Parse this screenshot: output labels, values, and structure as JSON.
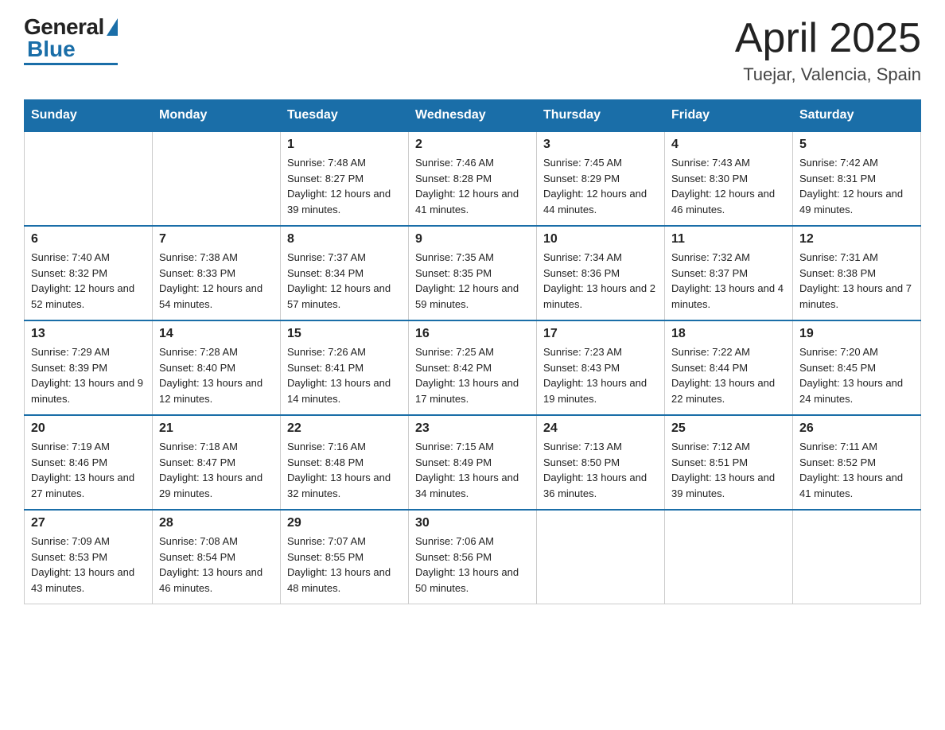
{
  "logo": {
    "general": "General",
    "blue": "Blue",
    "underline": "Blue"
  },
  "header": {
    "title": "April 2025",
    "subtitle": "Tuejar, Valencia, Spain"
  },
  "weekdays": [
    "Sunday",
    "Monday",
    "Tuesday",
    "Wednesday",
    "Thursday",
    "Friday",
    "Saturday"
  ],
  "weeks": [
    [
      {
        "day": "",
        "sunrise": "",
        "sunset": "",
        "daylight": ""
      },
      {
        "day": "",
        "sunrise": "",
        "sunset": "",
        "daylight": ""
      },
      {
        "day": "1",
        "sunrise": "Sunrise: 7:48 AM",
        "sunset": "Sunset: 8:27 PM",
        "daylight": "Daylight: 12 hours and 39 minutes."
      },
      {
        "day": "2",
        "sunrise": "Sunrise: 7:46 AM",
        "sunset": "Sunset: 8:28 PM",
        "daylight": "Daylight: 12 hours and 41 minutes."
      },
      {
        "day": "3",
        "sunrise": "Sunrise: 7:45 AM",
        "sunset": "Sunset: 8:29 PM",
        "daylight": "Daylight: 12 hours and 44 minutes."
      },
      {
        "day": "4",
        "sunrise": "Sunrise: 7:43 AM",
        "sunset": "Sunset: 8:30 PM",
        "daylight": "Daylight: 12 hours and 46 minutes."
      },
      {
        "day": "5",
        "sunrise": "Sunrise: 7:42 AM",
        "sunset": "Sunset: 8:31 PM",
        "daylight": "Daylight: 12 hours and 49 minutes."
      }
    ],
    [
      {
        "day": "6",
        "sunrise": "Sunrise: 7:40 AM",
        "sunset": "Sunset: 8:32 PM",
        "daylight": "Daylight: 12 hours and 52 minutes."
      },
      {
        "day": "7",
        "sunrise": "Sunrise: 7:38 AM",
        "sunset": "Sunset: 8:33 PM",
        "daylight": "Daylight: 12 hours and 54 minutes."
      },
      {
        "day": "8",
        "sunrise": "Sunrise: 7:37 AM",
        "sunset": "Sunset: 8:34 PM",
        "daylight": "Daylight: 12 hours and 57 minutes."
      },
      {
        "day": "9",
        "sunrise": "Sunrise: 7:35 AM",
        "sunset": "Sunset: 8:35 PM",
        "daylight": "Daylight: 12 hours and 59 minutes."
      },
      {
        "day": "10",
        "sunrise": "Sunrise: 7:34 AM",
        "sunset": "Sunset: 8:36 PM",
        "daylight": "Daylight: 13 hours and 2 minutes."
      },
      {
        "day": "11",
        "sunrise": "Sunrise: 7:32 AM",
        "sunset": "Sunset: 8:37 PM",
        "daylight": "Daylight: 13 hours and 4 minutes."
      },
      {
        "day": "12",
        "sunrise": "Sunrise: 7:31 AM",
        "sunset": "Sunset: 8:38 PM",
        "daylight": "Daylight: 13 hours and 7 minutes."
      }
    ],
    [
      {
        "day": "13",
        "sunrise": "Sunrise: 7:29 AM",
        "sunset": "Sunset: 8:39 PM",
        "daylight": "Daylight: 13 hours and 9 minutes."
      },
      {
        "day": "14",
        "sunrise": "Sunrise: 7:28 AM",
        "sunset": "Sunset: 8:40 PM",
        "daylight": "Daylight: 13 hours and 12 minutes."
      },
      {
        "day": "15",
        "sunrise": "Sunrise: 7:26 AM",
        "sunset": "Sunset: 8:41 PM",
        "daylight": "Daylight: 13 hours and 14 minutes."
      },
      {
        "day": "16",
        "sunrise": "Sunrise: 7:25 AM",
        "sunset": "Sunset: 8:42 PM",
        "daylight": "Daylight: 13 hours and 17 minutes."
      },
      {
        "day": "17",
        "sunrise": "Sunrise: 7:23 AM",
        "sunset": "Sunset: 8:43 PM",
        "daylight": "Daylight: 13 hours and 19 minutes."
      },
      {
        "day": "18",
        "sunrise": "Sunrise: 7:22 AM",
        "sunset": "Sunset: 8:44 PM",
        "daylight": "Daylight: 13 hours and 22 minutes."
      },
      {
        "day": "19",
        "sunrise": "Sunrise: 7:20 AM",
        "sunset": "Sunset: 8:45 PM",
        "daylight": "Daylight: 13 hours and 24 minutes."
      }
    ],
    [
      {
        "day": "20",
        "sunrise": "Sunrise: 7:19 AM",
        "sunset": "Sunset: 8:46 PM",
        "daylight": "Daylight: 13 hours and 27 minutes."
      },
      {
        "day": "21",
        "sunrise": "Sunrise: 7:18 AM",
        "sunset": "Sunset: 8:47 PM",
        "daylight": "Daylight: 13 hours and 29 minutes."
      },
      {
        "day": "22",
        "sunrise": "Sunrise: 7:16 AM",
        "sunset": "Sunset: 8:48 PM",
        "daylight": "Daylight: 13 hours and 32 minutes."
      },
      {
        "day": "23",
        "sunrise": "Sunrise: 7:15 AM",
        "sunset": "Sunset: 8:49 PM",
        "daylight": "Daylight: 13 hours and 34 minutes."
      },
      {
        "day": "24",
        "sunrise": "Sunrise: 7:13 AM",
        "sunset": "Sunset: 8:50 PM",
        "daylight": "Daylight: 13 hours and 36 minutes."
      },
      {
        "day": "25",
        "sunrise": "Sunrise: 7:12 AM",
        "sunset": "Sunset: 8:51 PM",
        "daylight": "Daylight: 13 hours and 39 minutes."
      },
      {
        "day": "26",
        "sunrise": "Sunrise: 7:11 AM",
        "sunset": "Sunset: 8:52 PM",
        "daylight": "Daylight: 13 hours and 41 minutes."
      }
    ],
    [
      {
        "day": "27",
        "sunrise": "Sunrise: 7:09 AM",
        "sunset": "Sunset: 8:53 PM",
        "daylight": "Daylight: 13 hours and 43 minutes."
      },
      {
        "day": "28",
        "sunrise": "Sunrise: 7:08 AM",
        "sunset": "Sunset: 8:54 PM",
        "daylight": "Daylight: 13 hours and 46 minutes."
      },
      {
        "day": "29",
        "sunrise": "Sunrise: 7:07 AM",
        "sunset": "Sunset: 8:55 PM",
        "daylight": "Daylight: 13 hours and 48 minutes."
      },
      {
        "day": "30",
        "sunrise": "Sunrise: 7:06 AM",
        "sunset": "Sunset: 8:56 PM",
        "daylight": "Daylight: 13 hours and 50 minutes."
      },
      {
        "day": "",
        "sunrise": "",
        "sunset": "",
        "daylight": ""
      },
      {
        "day": "",
        "sunrise": "",
        "sunset": "",
        "daylight": ""
      },
      {
        "day": "",
        "sunrise": "",
        "sunset": "",
        "daylight": ""
      }
    ]
  ]
}
